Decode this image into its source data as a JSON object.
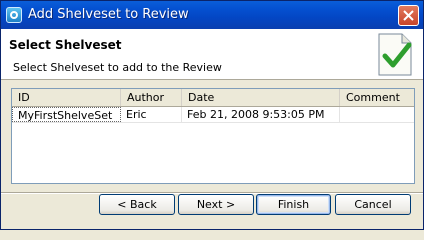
{
  "window": {
    "title": "Add Shelveset to Review"
  },
  "header": {
    "title": "Select Shelveset",
    "subtitle": "Select Shelveset to add to the Review"
  },
  "table": {
    "columns": [
      "ID",
      "Author",
      "Date",
      "Comment"
    ],
    "rows": [
      {
        "id": "MyFirstShelveSet",
        "author": "Eric",
        "date": "Feb 21, 2008 9:53:05 PM",
        "comment": ""
      }
    ]
  },
  "buttons": {
    "back": "< Back",
    "next": "Next >",
    "finish": "Finish",
    "cancel": "Cancel"
  },
  "icons": {
    "app": "app-icon",
    "close": "close-icon",
    "document": "document-check-icon"
  },
  "colors": {
    "titlebar": "#0450d0",
    "check": "#2e9e2e",
    "close": "#c8442a"
  }
}
